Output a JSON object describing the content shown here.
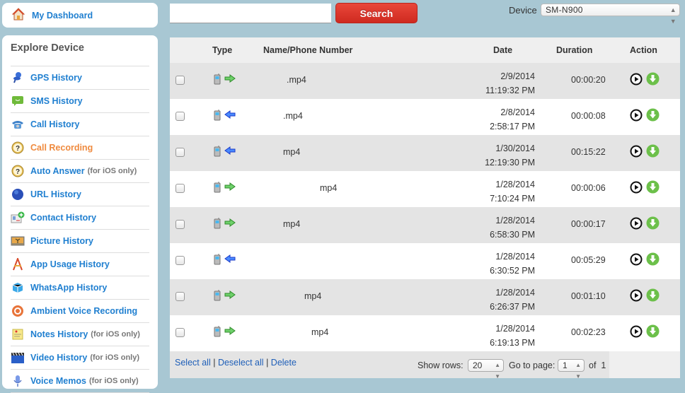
{
  "dashboard": {
    "label": "My Dashboard",
    "icon": "home-icon"
  },
  "sidebar": {
    "title": "Explore Device",
    "items": [
      {
        "label": "GPS History",
        "icon": "pushpin-icon",
        "note": ""
      },
      {
        "label": "SMS History",
        "icon": "chat-bubble-icon",
        "note": ""
      },
      {
        "label": "Call History",
        "icon": "telephone-icon",
        "note": ""
      },
      {
        "label": "Call Recording",
        "icon": "question-icon",
        "note": "",
        "active": true
      },
      {
        "label": "Auto Answer",
        "icon": "question-icon",
        "note": "(for iOS only)"
      },
      {
        "label": "URL History",
        "icon": "globe-icon",
        "note": ""
      },
      {
        "label": "Contact History",
        "icon": "contact-card-icon",
        "note": ""
      },
      {
        "label": "Picture History",
        "icon": "picture-icon",
        "note": ""
      },
      {
        "label": "App Usage History",
        "icon": "app-store-icon",
        "note": ""
      },
      {
        "label": "WhatsApp History",
        "icon": "box-icon",
        "note": ""
      },
      {
        "label": "Ambient Voice Recording",
        "icon": "target-icon",
        "note": ""
      },
      {
        "label": "Notes History",
        "icon": "sticky-note-icon",
        "note": "(for iOS only)"
      },
      {
        "label": "Video History",
        "icon": "clapperboard-icon",
        "note": "(for iOS only)"
      },
      {
        "label": "Voice Memos",
        "icon": "microphone-icon",
        "note": "(for iOS only)"
      }
    ]
  },
  "search": {
    "value": "",
    "placeholder": "",
    "button_label": "Search"
  },
  "device": {
    "label": "Device",
    "selected": "SM-N900"
  },
  "table": {
    "headers": {
      "type": "Type",
      "name": "Name/Phone Number",
      "date": "Date",
      "duration": "Duration",
      "action": "Action"
    },
    "rows": [
      {
        "direction": "outgoing",
        "name": ".mp4",
        "date": "2/9/2014",
        "time": "11:19:32 PM",
        "duration": "00:00:20"
      },
      {
        "direction": "incoming",
        "name": ".mp4",
        "date": "2/8/2014",
        "time": "2:58:17 PM",
        "duration": "00:00:08"
      },
      {
        "direction": "incoming",
        "name": "mp4",
        "date": "1/30/2014",
        "time": "12:19:30 PM",
        "duration": "00:15:22"
      },
      {
        "direction": "outgoing",
        "name": "mp4",
        "date": "1/28/2014",
        "time": "7:10:24 PM",
        "duration": "00:00:06"
      },
      {
        "direction": "outgoing",
        "name": "mp4",
        "date": "1/28/2014",
        "time": "6:58:30 PM",
        "duration": "00:00:17"
      },
      {
        "direction": "incoming",
        "name": "",
        "date": "1/28/2014",
        "time": "6:30:52 PM",
        "duration": "00:05:29"
      },
      {
        "direction": "outgoing",
        "name": "mp4",
        "date": "1/28/2014",
        "time": "6:26:37 PM",
        "duration": "00:01:10"
      },
      {
        "direction": "outgoing",
        "name": "mp4",
        "date": "1/28/2014",
        "time": "6:19:13 PM",
        "duration": "00:02:23"
      }
    ]
  },
  "footer": {
    "select_all": "Select all",
    "deselect_all": "Deselect all",
    "delete": "Delete",
    "separator": "|",
    "show_rows_label": "Show rows:",
    "show_rows_value": "20",
    "goto_label": "Go to page:",
    "page_value": "1",
    "of_label": "of",
    "total_pages": "1"
  },
  "colors": {
    "accent": "#1f7fd0",
    "active": "#ef8a3e",
    "search_button": "#d9352a",
    "background": "#a8c7d3"
  }
}
